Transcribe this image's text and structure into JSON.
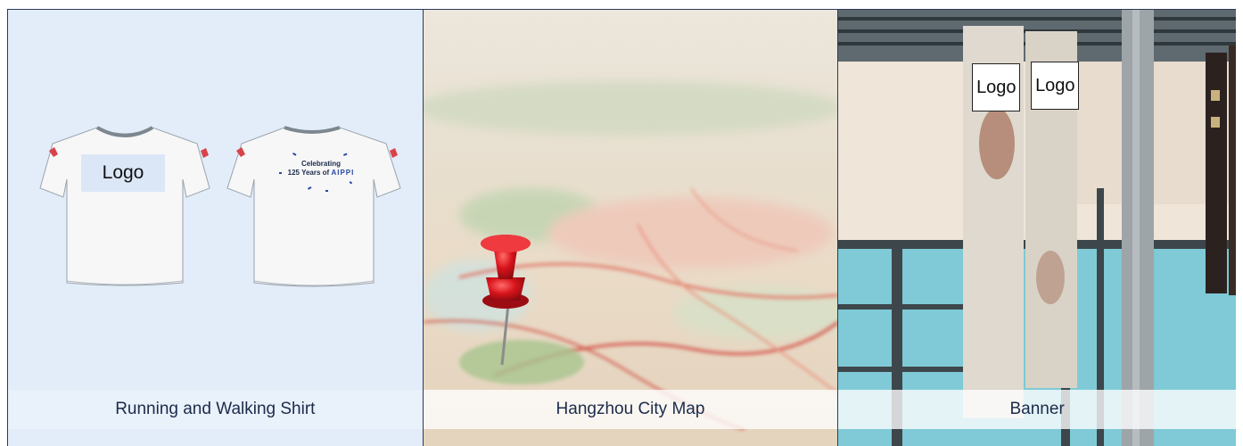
{
  "cards": [
    {
      "caption": "Running and Walking Shirt",
      "logo_label": "Logo",
      "back_print_line1": "Celebrating",
      "back_print_line2": "125 Years of",
      "back_print_brand": "AIPPI"
    },
    {
      "caption": "Hangzhou City Map"
    },
    {
      "caption": "Banner",
      "logo_labels": [
        "Logo",
        "Logo"
      ]
    }
  ],
  "colors": {
    "shirt_panel_bg": "#e3edf9",
    "caption_text": "#1c2b4a",
    "pin_red": "#d8141c",
    "border": "#2e3a55"
  }
}
